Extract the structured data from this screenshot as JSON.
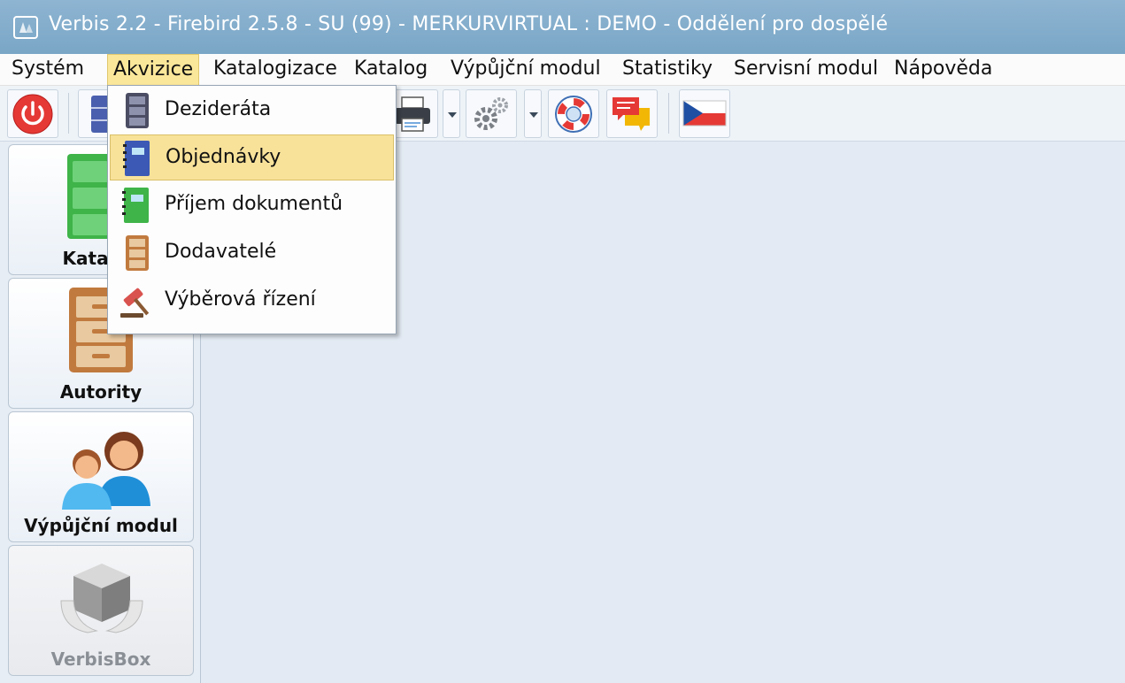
{
  "window": {
    "title": "Verbis 2.2 - Firebird 2.5.8 - SU (99) - MERKURVIRTUAL : DEMO - Oddělení pro dospělé"
  },
  "menubar": {
    "items": [
      "Systém",
      "Akvizice",
      "Katalogizace",
      "Katalog",
      "Výpůjční modul",
      "Statistiky",
      "Servisní modul",
      "Nápověda"
    ],
    "active": "Akvizice"
  },
  "dropdown": {
    "items": [
      {
        "label": "Dezideráta",
        "icon": "cabinet-dark-icon"
      },
      {
        "label": "Objednávky",
        "icon": "notebook-blue-icon",
        "selected": true
      },
      {
        "label": "Příjem dokumentů",
        "icon": "notebook-green-icon"
      },
      {
        "label": "Dodavatelé",
        "icon": "cabinet-brown-icon"
      },
      {
        "label": "Výběrová řízení",
        "icon": "gavel-icon"
      }
    ]
  },
  "toolbar": {
    "buttons": [
      "power-icon",
      "cabinet-icon",
      "printer-icon",
      "gear-icon",
      "lifebuoy-icon",
      "chat-icon",
      "czech-flag-icon"
    ]
  },
  "modules": [
    {
      "label": "Katalog",
      "icon": "green-cabinet-icon",
      "enabled": true
    },
    {
      "label": "Autority",
      "icon": "brown-cabinet-icon",
      "enabled": true
    },
    {
      "label": "Výpůjční modul",
      "icon": "users-icon",
      "enabled": true
    },
    {
      "label": "VerbisBox",
      "icon": "box-hands-icon",
      "enabled": false
    }
  ],
  "colors": {
    "titlebar": "#7aa6c6",
    "menu_highlight": "#fbe79a",
    "workspace": "#e3eaf3",
    "power": "#e53935"
  }
}
